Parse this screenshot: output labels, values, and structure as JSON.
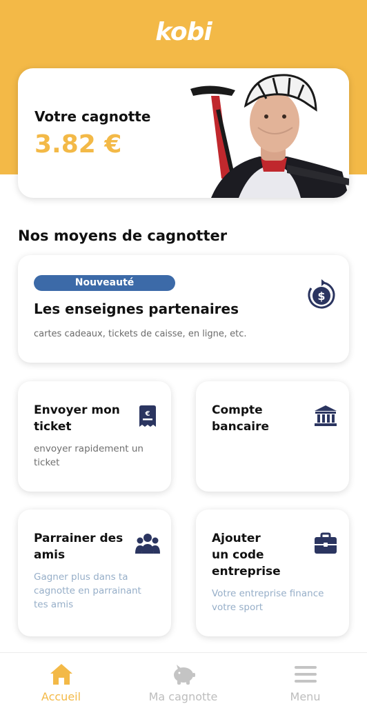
{
  "app": {
    "logo": "kobi"
  },
  "wallet": {
    "label": "Votre cagnotte",
    "amount": "3.82 €"
  },
  "section_title": "Nos moyens de cagnotter",
  "partners": {
    "badge": "Nouveauté",
    "title": "Les enseignes partenaires",
    "subtitle": "cartes cadeaux, tickets de caisse, en ligne, etc.",
    "icon": "dollar-refresh-icon"
  },
  "cards": {
    "ticket": {
      "title": "Envoyer mon\nticket",
      "desc": "envoyer rapidement un ticket",
      "icon": "receipt-euro-icon"
    },
    "bank": {
      "title": "Compte\nbancaire",
      "icon": "bank-icon"
    },
    "friends": {
      "title": "Parrainer des\namis",
      "desc": "Gagner plus dans ta cagnotte en parrainant tes amis",
      "icon": "group-icon"
    },
    "company": {
      "title": "Ajouter\nun code\nentreprise",
      "desc": "Votre entreprise finance votre sport",
      "icon": "briefcase-icon"
    }
  },
  "tabbar": {
    "items": [
      {
        "label": "Accueil",
        "icon": "home-icon",
        "active": true
      },
      {
        "label": "Ma cagnotte",
        "icon": "piggy-bank-icon",
        "active": false
      },
      {
        "label": "Menu",
        "icon": "menu-icon",
        "active": false
      }
    ]
  },
  "colors": {
    "brand": "#f3b947",
    "navy": "#2b3560",
    "badge": "#3c6aa8",
    "muted_blue": "#96aec8"
  }
}
